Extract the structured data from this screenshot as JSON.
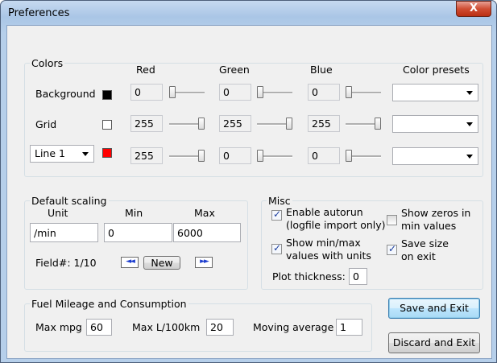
{
  "window": {
    "title": "Preferences",
    "close_label": "X"
  },
  "colors": {
    "group_label": "Colors",
    "headers": {
      "red": "Red",
      "green": "Green",
      "blue": "Blue",
      "presets": "Color presets"
    },
    "rows": [
      {
        "label": "Background",
        "swatch": "#000000",
        "red": "0",
        "green": "0",
        "blue": "0",
        "preset": "",
        "red_level": 0,
        "green_level": 0,
        "blue_level": 0
      },
      {
        "label": "Grid",
        "swatch": "#ffffff",
        "red": "255",
        "green": "255",
        "blue": "255",
        "preset": "",
        "red_level": 1,
        "green_level": 1,
        "blue_level": 1
      },
      {
        "label": "Line 1",
        "swatch": "#ff0000",
        "red": "255",
        "green": "0",
        "blue": "0",
        "preset": "",
        "red_level": 1,
        "green_level": 0,
        "blue_level": 0
      }
    ]
  },
  "scaling": {
    "group_label": "Default scaling",
    "unit_label": "Unit",
    "min_label": "Min",
    "max_label": "Max",
    "unit_value": "/min",
    "min_value": "0",
    "max_value": "6000",
    "field_label": "Field#: 1/10",
    "prev_label": "◄◄",
    "new_label": "New",
    "next_label": "►►"
  },
  "misc": {
    "group_label": "Misc",
    "autorun_line1": "Enable autorun",
    "autorun_line2": "(logfile import only)",
    "autorun_checked": true,
    "zeros_line1": "Show zeros in",
    "zeros_line2": "min values",
    "zeros_checked": false,
    "minmax_line1": "Show min/max",
    "minmax_line2": "values with units",
    "minmax_checked": true,
    "savesize_line1": "Save size",
    "savesize_line2": "on exit",
    "savesize_checked": true,
    "plot_label": "Plot thickness:",
    "plot_value": "0"
  },
  "fuel": {
    "group_label": "Fuel Mileage and Consumption",
    "mpg_label": "Max mpg",
    "mpg_value": "60",
    "l100_label": "Max L/100km",
    "l100_value": "20",
    "avg_label": "Moving average",
    "avg_value": "1"
  },
  "buttons": {
    "save_exit": "Save and Exit",
    "discard_exit": "Discard and Exit"
  }
}
